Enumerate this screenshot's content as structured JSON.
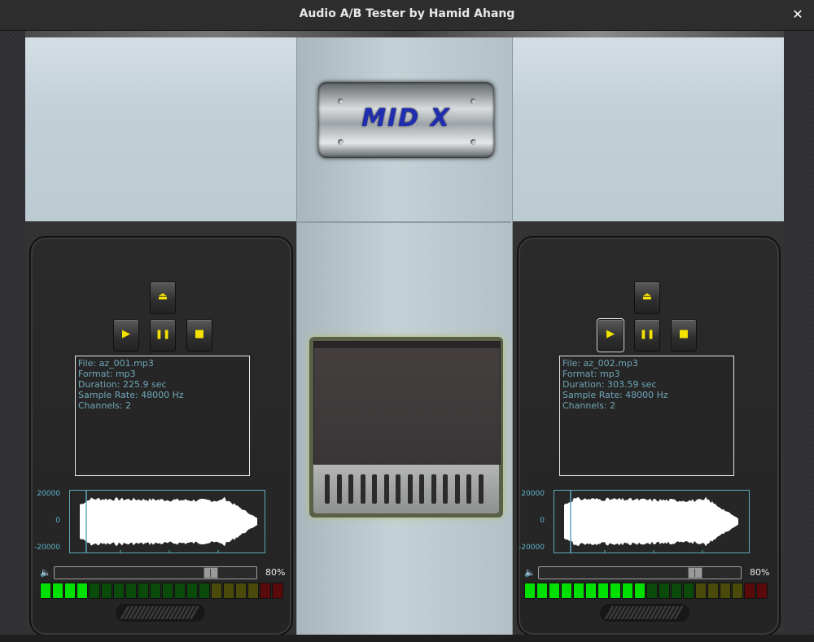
{
  "window": {
    "title": "Audio A/B Tester by Hamid Ahang",
    "close_glyph": "✕"
  },
  "logo": {
    "text": "MID X"
  },
  "colors": {
    "accent_yellow": "#f4e300",
    "info_text": "#6fa6b8",
    "wave_border": "#5fa9ba",
    "meter_green_on": "#00e000",
    "meter_green_off": "#0a4a0a",
    "meter_yellow_off": "#4a4a0a",
    "meter_red_off": "#5a0a0a"
  },
  "icons": {
    "eject": "eject-icon",
    "play": "play-icon",
    "pause": "pause-icon",
    "stop": "stop-icon",
    "volume": "volume-icon"
  },
  "deck_a": {
    "buttons": {
      "eject": "⏏",
      "play": "▶",
      "pause": "❚❚",
      "stop": "■"
    },
    "selected_button": "",
    "info": {
      "file": "File: az_001.mp3",
      "format": "Format: mp3",
      "duration": "Duration: 225.9 sec",
      "sample_rate": "Sample Rate: 48000 Hz",
      "channels": "Channels: 2"
    },
    "waveform": {
      "y_ticks": [
        "20000",
        "0",
        "-20000"
      ]
    },
    "volume": {
      "label": "80%",
      "value": 0.8
    },
    "meter": {
      "total_segments": 20,
      "lit_green": 4,
      "green_segments": 14,
      "yellow_segments": 4,
      "red_segments": 2
    }
  },
  "deck_b": {
    "buttons": {
      "eject": "⏏",
      "play": "▶",
      "pause": "❚❚",
      "stop": "■"
    },
    "selected_button": "play",
    "info": {
      "file": "File: az_002.mp3",
      "format": "Format: mp3",
      "duration": "Duration: 303.59 sec",
      "sample_rate": "Sample Rate: 48000 Hz",
      "channels": "Channels: 2"
    },
    "waveform": {
      "y_ticks": [
        "20000",
        "0",
        "-20000"
      ]
    },
    "volume": {
      "label": "80%",
      "value": 0.8
    },
    "meter": {
      "total_segments": 20,
      "lit_green": 10,
      "green_segments": 14,
      "yellow_segments": 4,
      "red_segments": 2
    }
  }
}
